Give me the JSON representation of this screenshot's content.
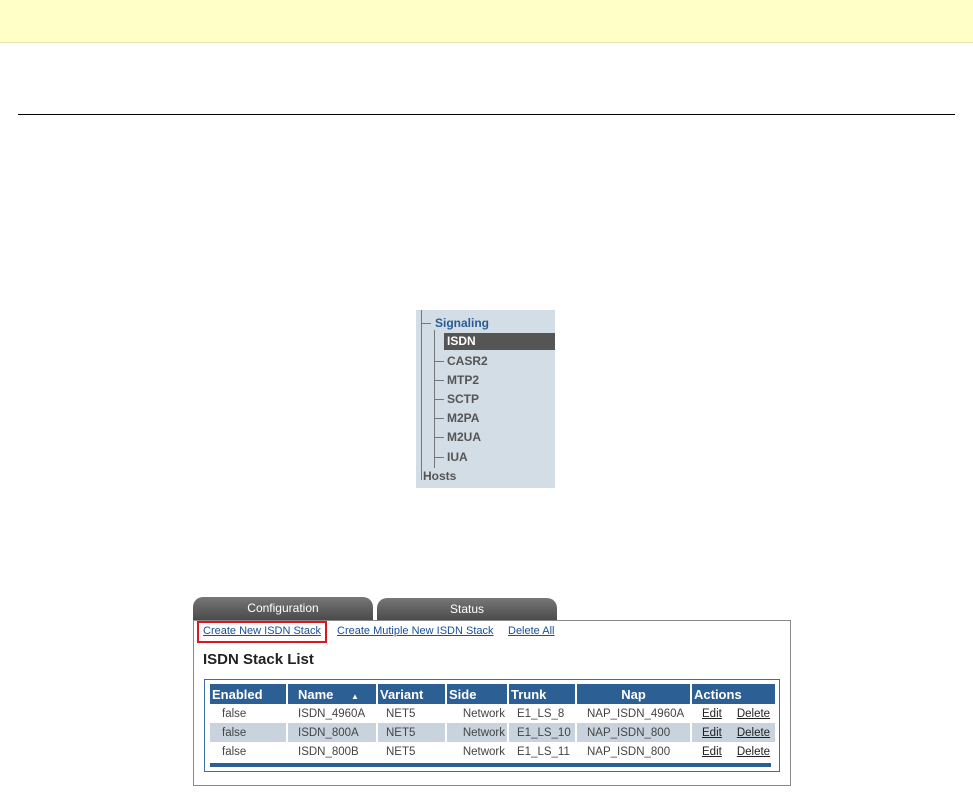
{
  "tree": {
    "parent": "Signaling",
    "items": [
      "ISDN",
      "CASR2",
      "MTP2",
      "SCTP",
      "M2PA",
      "M2UA",
      "IUA"
    ],
    "selected": "ISDN",
    "sibling": "Hosts"
  },
  "tabs": [
    "Configuration",
    "Status"
  ],
  "links": [
    "Create New ISDN Stack",
    "Create Mutiple New ISDN Stack",
    "Delete All"
  ],
  "list_title": "ISDN Stack List",
  "table": {
    "headers": [
      "Enabled",
      "Name",
      "Variant",
      "Side",
      "Trunk",
      "Nap",
      "Actions"
    ],
    "rows": [
      {
        "enabled": "false",
        "name": "ISDN_4960A",
        "variant": "NET5",
        "side": "Network",
        "trunk": "E1_LS_8",
        "nap": "NAP_ISDN_4960A",
        "edit": "Edit",
        "delete": "Delete"
      },
      {
        "enabled": "false",
        "name": "ISDN_800A",
        "variant": "NET5",
        "side": "Network",
        "trunk": "E1_LS_10",
        "nap": "NAP_ISDN_800",
        "edit": "Edit",
        "delete": "Delete"
      },
      {
        "enabled": "false",
        "name": "ISDN_800B",
        "variant": "NET5",
        "side": "Network",
        "trunk": "E1_LS_11",
        "nap": "NAP_ISDN_800",
        "edit": "Edit",
        "delete": "Delete"
      }
    ]
  }
}
